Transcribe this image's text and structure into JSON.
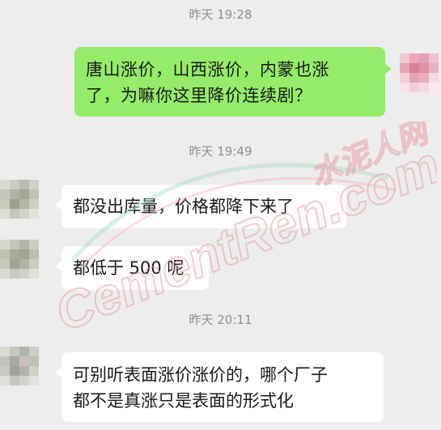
{
  "timestamps": [
    "昨天 19:28",
    "昨天 19:49",
    "昨天 20:11"
  ],
  "messages": [
    {
      "direction": "outgoing",
      "text": "唐山涨价，山西涨价，内蒙也涨\n了，为嘛你这里降价连续剧？"
    },
    {
      "direction": "incoming",
      "text": "都没出库量，价格都降下来了"
    },
    {
      "direction": "incoming",
      "text": "都低于 500 呢"
    },
    {
      "direction": "incoming",
      "text": "可别听表面涨价涨价的，哪个厂子\n都不是真涨只是表面的形式化"
    }
  ],
  "watermark": {
    "main": "CementRen.com",
    "cn": "水泥人网"
  },
  "colors": {
    "background": "#ededed",
    "outgoing_bubble": "#95ec69",
    "incoming_bubble": "#ffffff",
    "timestamp": "#8e8e8e",
    "watermark": "#e8a0a8"
  }
}
